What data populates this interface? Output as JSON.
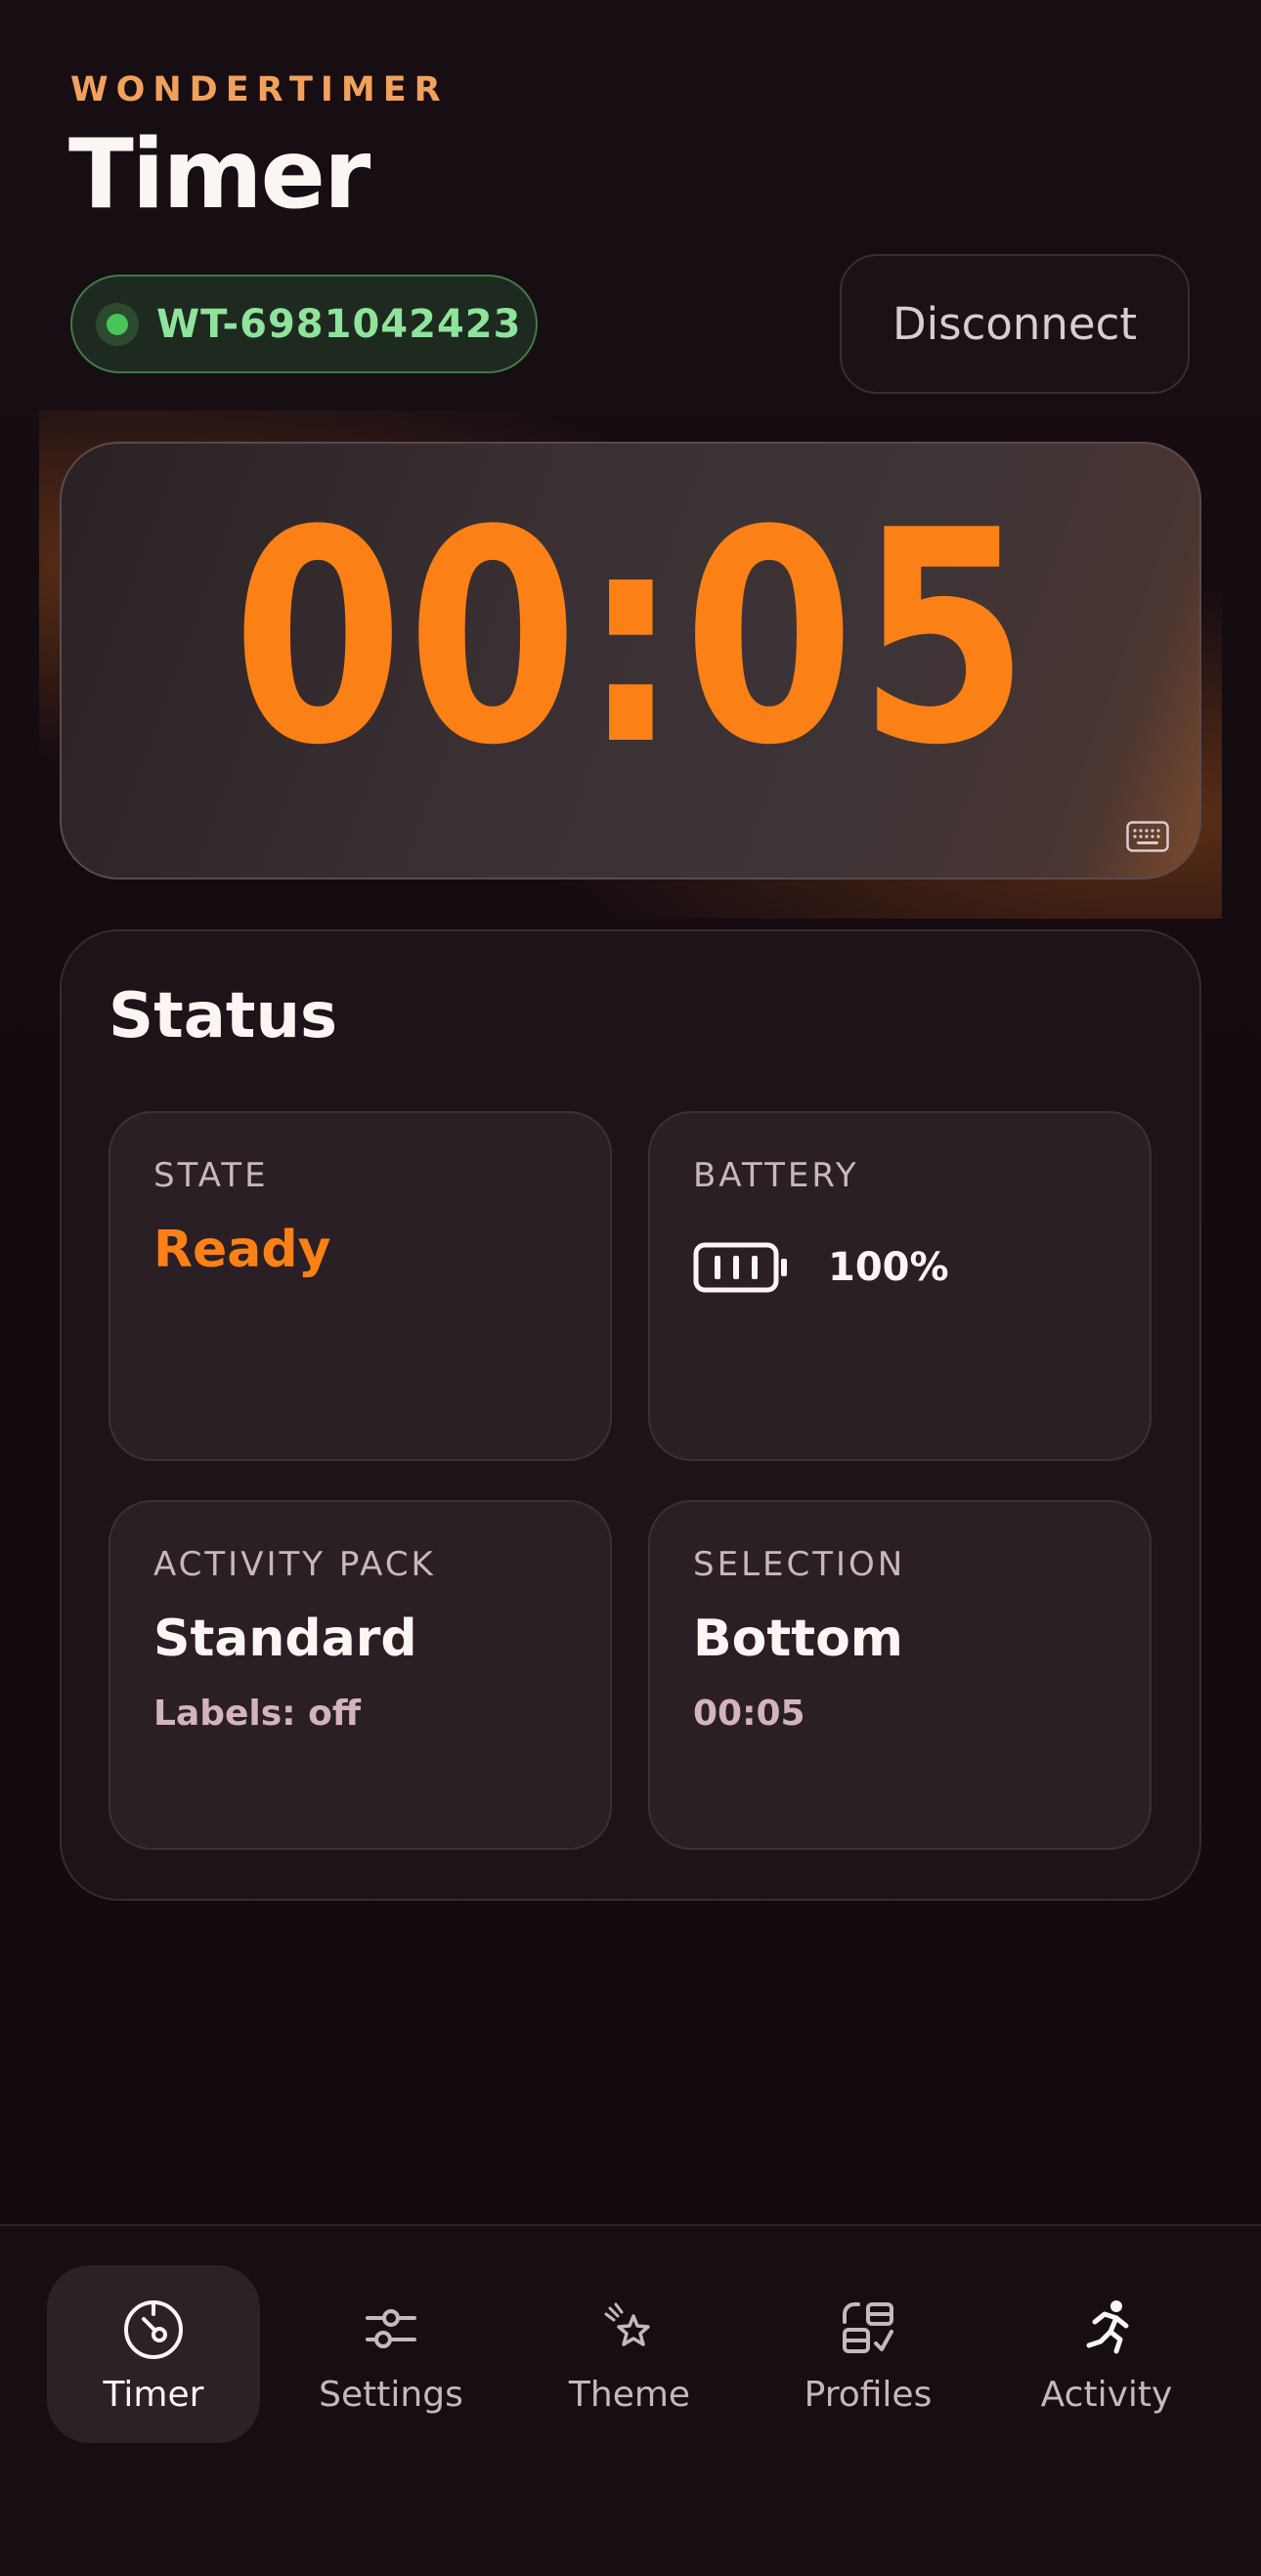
{
  "header": {
    "brand": "WONDERTIMER",
    "title": "Timer",
    "device_id": "WT-6981042423",
    "disconnect_label": "Disconnect"
  },
  "timer": {
    "display": "00:05"
  },
  "status": {
    "title": "Status",
    "state": {
      "label": "STATE",
      "value": "Ready"
    },
    "battery": {
      "label": "BATTERY",
      "value": "100%",
      "level": 1.0
    },
    "activity_pack": {
      "label": "ACTIVITY PACK",
      "value": "Standard",
      "sub": "Labels: off"
    },
    "selection": {
      "label": "SELECTION",
      "value": "Bottom",
      "sub": "00:05"
    }
  },
  "nav": {
    "items": [
      {
        "label": "Timer",
        "icon": "timer-icon",
        "active": true
      },
      {
        "label": "Settings",
        "icon": "sliders-icon",
        "active": false
      },
      {
        "label": "Theme",
        "icon": "theme-sparkle-icon",
        "active": false
      },
      {
        "label": "Profiles",
        "icon": "profiles-icon",
        "active": false
      },
      {
        "label": "Activity",
        "icon": "running-person-icon",
        "active": false
      }
    ]
  },
  "colors": {
    "accent": "#fb8116",
    "brand": "#f2a15c",
    "connected": "#47c559",
    "background": "#130b10"
  }
}
